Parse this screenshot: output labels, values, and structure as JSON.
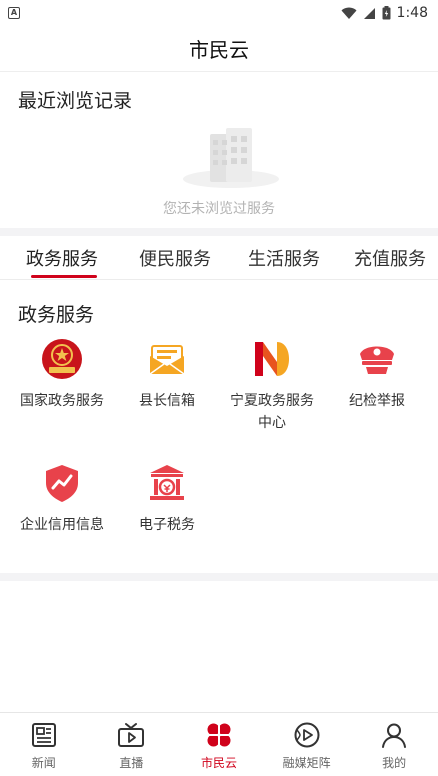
{
  "status_bar": {
    "time": "1:48"
  },
  "header": {
    "title": "市民云"
  },
  "recent": {
    "title": "最近浏览记录",
    "empty_text": "您还未浏览过服务"
  },
  "tabs": [
    {
      "label": "政务服务",
      "active": true
    },
    {
      "label": "便民服务",
      "active": false
    },
    {
      "label": "生活服务",
      "active": false
    },
    {
      "label": "充值服务",
      "active": false
    }
  ],
  "section": {
    "title": "政务服务",
    "services": [
      {
        "label": "国家政务服务",
        "icon": "national-emblem-icon"
      },
      {
        "label": "县长信箱",
        "icon": "mailbox-icon"
      },
      {
        "label": "宁夏政务服务中心",
        "icon": "ningxia-logo-icon"
      },
      {
        "label": "纪检举报",
        "icon": "police-cap-icon"
      },
      {
        "label": "企业信用信息",
        "icon": "credit-shield-icon"
      },
      {
        "label": "电子税务",
        "icon": "tax-building-icon"
      }
    ]
  },
  "bottom_nav": [
    {
      "label": "新闻",
      "icon": "news-icon"
    },
    {
      "label": "直播",
      "icon": "tv-icon"
    },
    {
      "label": "市民云",
      "icon": "clover-icon",
      "active": true
    },
    {
      "label": "融媒矩阵",
      "icon": "play-circle-icon"
    },
    {
      "label": "我的",
      "icon": "user-icon"
    }
  ],
  "colors": {
    "accent": "#d0021b",
    "orange": "#f5a623",
    "muted": "#b3b3b3"
  }
}
